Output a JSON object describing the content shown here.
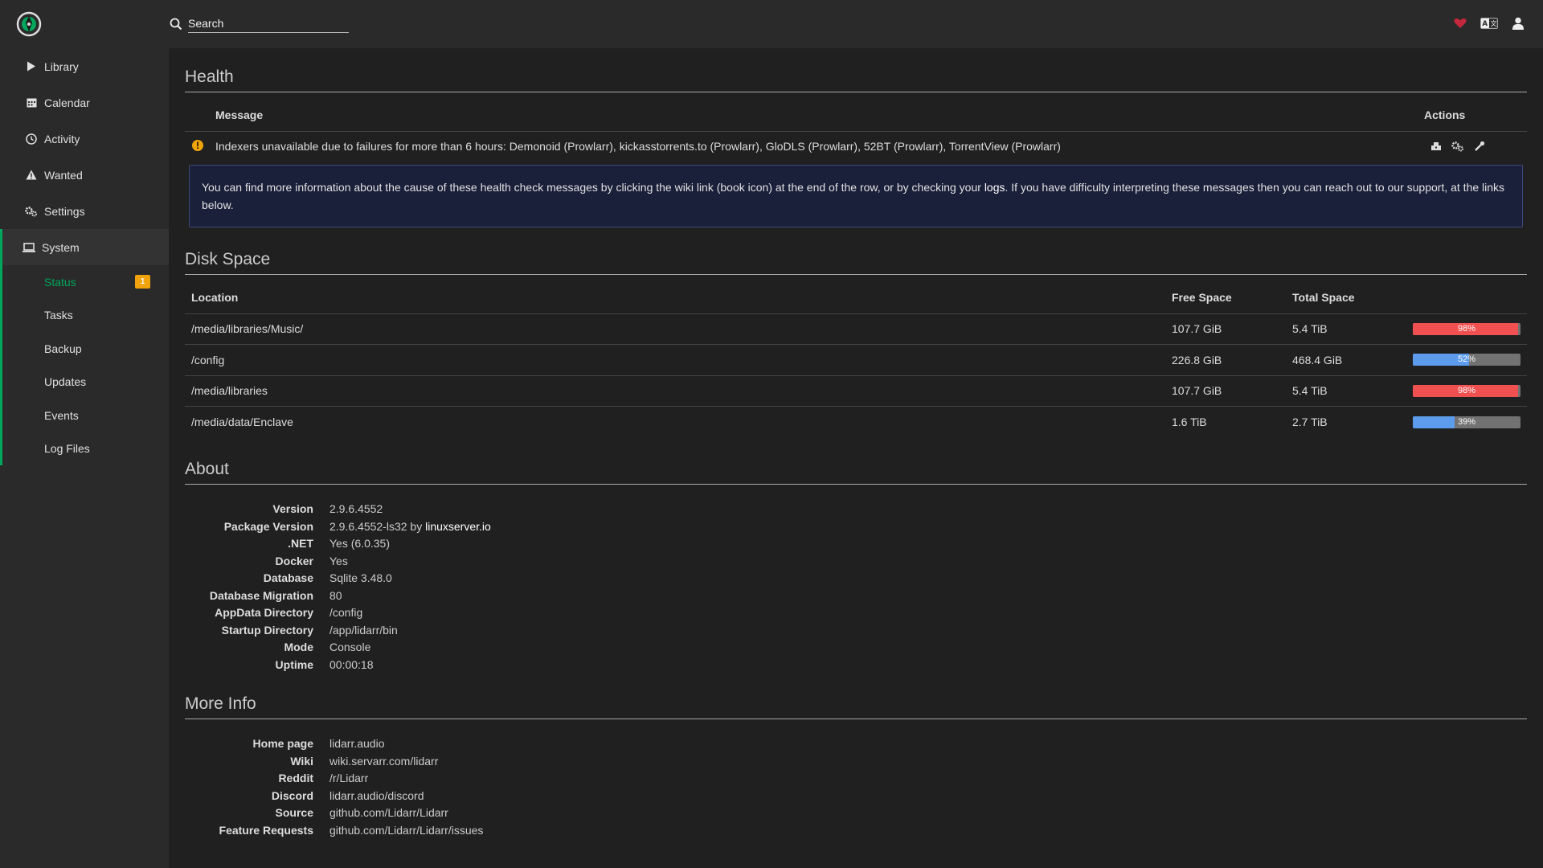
{
  "header": {
    "search_placeholder": "Search",
    "icons": [
      "heart-icon",
      "translate-icon",
      "user-icon"
    ]
  },
  "sidebar": {
    "items": [
      {
        "label": "Library",
        "icon": "play-icon"
      },
      {
        "label": "Calendar",
        "icon": "calendar-icon"
      },
      {
        "label": "Activity",
        "icon": "clock-icon"
      },
      {
        "label": "Wanted",
        "icon": "warning-icon"
      },
      {
        "label": "Settings",
        "icon": "gears-icon"
      },
      {
        "label": "System",
        "icon": "laptop-icon"
      }
    ],
    "sub_items": [
      {
        "label": "Status",
        "badge": "1"
      },
      {
        "label": "Tasks"
      },
      {
        "label": "Backup"
      },
      {
        "label": "Updates"
      },
      {
        "label": "Events"
      },
      {
        "label": "Log Files"
      }
    ]
  },
  "health": {
    "title": "Health",
    "col_message": "Message",
    "col_actions": "Actions",
    "row_message": "Indexers unavailable due to failures for more than 6 hours: Demonoid (Prowlarr), kickasstorrents.to (Prowlarr), GloDLS (Prowlarr), 52BT (Prowlarr), TorrentView (Prowlarr)",
    "info_pre": "You can find more information about the cause of these health check messages by clicking the wiki link (book icon) at the end of the row, or by checking your ",
    "info_link": "logs",
    "info_post": ". If you have difficulty interpreting these messages then you can reach out to our support, at the links below."
  },
  "disk": {
    "title": "Disk Space",
    "col_location": "Location",
    "col_free": "Free Space",
    "col_total": "Total Space",
    "rows": [
      {
        "location": "/media/libraries/Music/",
        "free": "107.7 GiB",
        "total": "5.4 TiB",
        "percent": 98,
        "percent_label": "98%",
        "color": "#f05050"
      },
      {
        "location": "/config",
        "free": "226.8 GiB",
        "total": "468.4 GiB",
        "percent": 52,
        "percent_label": "52%",
        "color": "#5d9cec"
      },
      {
        "location": "/media/libraries",
        "free": "107.7 GiB",
        "total": "5.4 TiB",
        "percent": 98,
        "percent_label": "98%",
        "color": "#f05050"
      },
      {
        "location": "/media/data/Enclave",
        "free": "1.6 TiB",
        "total": "2.7 TiB",
        "percent": 39,
        "percent_label": "39%",
        "color": "#5d9cec"
      }
    ]
  },
  "about": {
    "title": "About",
    "version_label": "Version",
    "version": "2.9.6.4552",
    "package_label": "Package Version",
    "package": "2.9.6.4552-ls32 by ",
    "package_link": "linuxserver.io",
    "net_label": ".NET",
    "net": "Yes (6.0.35)",
    "docker_label": "Docker",
    "docker": "Yes",
    "database_label": "Database",
    "database": "Sqlite 3.48.0",
    "migration_label": "Database Migration",
    "migration": "80",
    "appdata_label": "AppData Directory",
    "appdata": "/config",
    "startup_label": "Startup Directory",
    "startup": "/app/lidarr/bin",
    "mode_label": "Mode",
    "mode": "Console",
    "uptime_label": "Uptime",
    "uptime": "00:00:18"
  },
  "more_info": {
    "title": "More Info",
    "home_label": "Home page",
    "home": "lidarr.audio",
    "wiki_label": "Wiki",
    "wiki": "wiki.servarr.com/lidarr",
    "reddit_label": "Reddit",
    "reddit": "/r/Lidarr",
    "discord_label": "Discord",
    "discord": "lidarr.audio/discord",
    "source_label": "Source",
    "source": "github.com/Lidarr/Lidarr",
    "feature_label": "Feature Requests",
    "feature": "github.com/Lidarr/Lidarr/issues"
  },
  "colors": {
    "accent": "#00a65b",
    "warning": "#f0a30a",
    "danger": "#f05050",
    "primary": "#5d9cec"
  }
}
